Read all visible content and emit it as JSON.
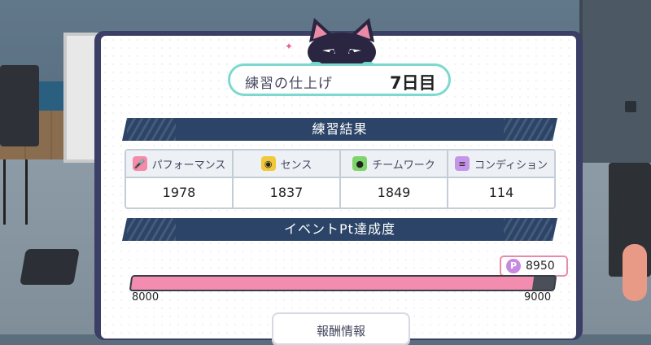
{
  "header": {
    "title_left": "練習の仕上げ",
    "title_right": "7日目"
  },
  "results": {
    "title": "練習結果",
    "stats": [
      {
        "label": "パフォーマンス",
        "value": "1978",
        "icon": "microphone-icon"
      },
      {
        "label": "センス",
        "value": "1837",
        "icon": "sense-icon"
      },
      {
        "label": "チームワーク",
        "value": "1849",
        "icon": "teamwork-icon"
      },
      {
        "label": "コンディション",
        "value": "114",
        "icon": "condition-icon"
      }
    ]
  },
  "event": {
    "title": "イベントPt達成度",
    "min": "8000",
    "max": "9000",
    "current": "8950",
    "progress_fraction": 0.95,
    "icon": "event-point-icon"
  },
  "reward_button": {
    "label": "報酬情報"
  },
  "colors": {
    "banner": "#2b4467",
    "accent_teal": "#7dd9cf",
    "progress_pink": "#f38db0",
    "panel_frame": "#3b3f66"
  }
}
